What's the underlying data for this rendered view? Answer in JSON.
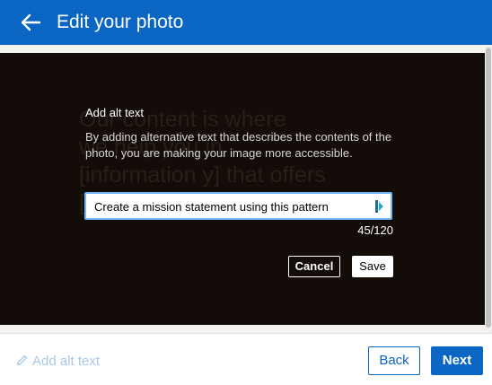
{
  "header": {
    "title": "Edit your photo"
  },
  "photo": {
    "background_text": "Our content is where\nwe help you in\n[information y] that offers\n[benefit 2]."
  },
  "alt_text_panel": {
    "title": "Add alt text",
    "description": "By adding alternative text that describes the contents of the photo, you are making your image more accessible.",
    "input_value": "Create a mission statement using this pattern",
    "counter": "45/120",
    "cancel_label": "Cancel",
    "save_label": "Save"
  },
  "footer": {
    "add_alt_text_label": "Add alt text",
    "back_label": "Back",
    "next_label": "Next"
  },
  "colors": {
    "brand": "#0a66c2",
    "photo_bg": "#140c08",
    "input_focus": "#70b5f9"
  },
  "icons": [
    "back-arrow-icon",
    "input-extension-icon",
    "pencil-icon"
  ]
}
